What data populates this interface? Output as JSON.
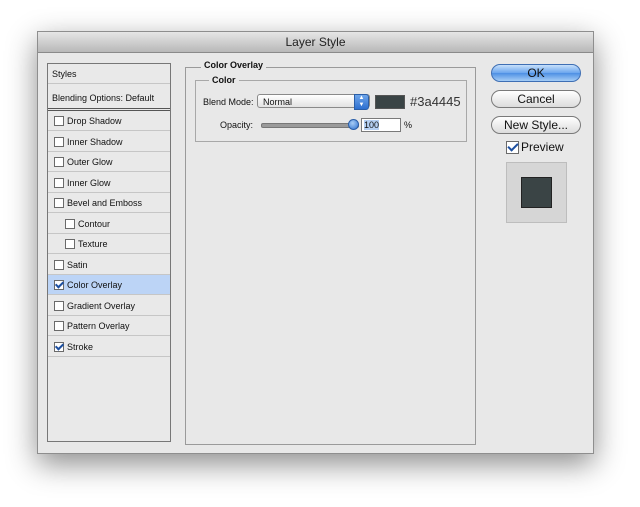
{
  "window": {
    "title": "Layer Style"
  },
  "styles_panel": {
    "header": "Styles",
    "blending_options": "Blending Options: Default",
    "items": [
      {
        "label": "Drop Shadow",
        "checked": false,
        "indent": false,
        "selected": false
      },
      {
        "label": "Inner Shadow",
        "checked": false,
        "indent": false,
        "selected": false
      },
      {
        "label": "Outer Glow",
        "checked": false,
        "indent": false,
        "selected": false
      },
      {
        "label": "Inner Glow",
        "checked": false,
        "indent": false,
        "selected": false
      },
      {
        "label": "Bevel and Emboss",
        "checked": false,
        "indent": false,
        "selected": false
      },
      {
        "label": "Contour",
        "checked": false,
        "indent": true,
        "selected": false
      },
      {
        "label": "Texture",
        "checked": false,
        "indent": true,
        "selected": false
      },
      {
        "label": "Satin",
        "checked": false,
        "indent": false,
        "selected": false
      },
      {
        "label": "Color Overlay",
        "checked": true,
        "indent": false,
        "selected": true
      },
      {
        "label": "Gradient Overlay",
        "checked": false,
        "indent": false,
        "selected": false
      },
      {
        "label": "Pattern Overlay",
        "checked": false,
        "indent": false,
        "selected": false
      },
      {
        "label": "Stroke",
        "checked": true,
        "indent": false,
        "selected": false
      }
    ]
  },
  "color_overlay": {
    "group_title": "Color Overlay",
    "subgroup_title": "Color",
    "blend_mode_label": "Blend Mode:",
    "blend_mode_value": "Normal",
    "color_hex": "#3a4445",
    "opacity_label": "Opacity:",
    "opacity_value": "100",
    "opacity_fraction": 1.0,
    "opacity_unit": "%"
  },
  "buttons": {
    "ok": "OK",
    "cancel": "Cancel",
    "new_style": "New Style..."
  },
  "preview": {
    "label": "Preview",
    "checked": true,
    "color": "#3a4445"
  },
  "colors": {
    "accent": "#4d8fe4",
    "selected_row": "#bcd4f6",
    "dialog_bg": "#e8e8e8"
  }
}
